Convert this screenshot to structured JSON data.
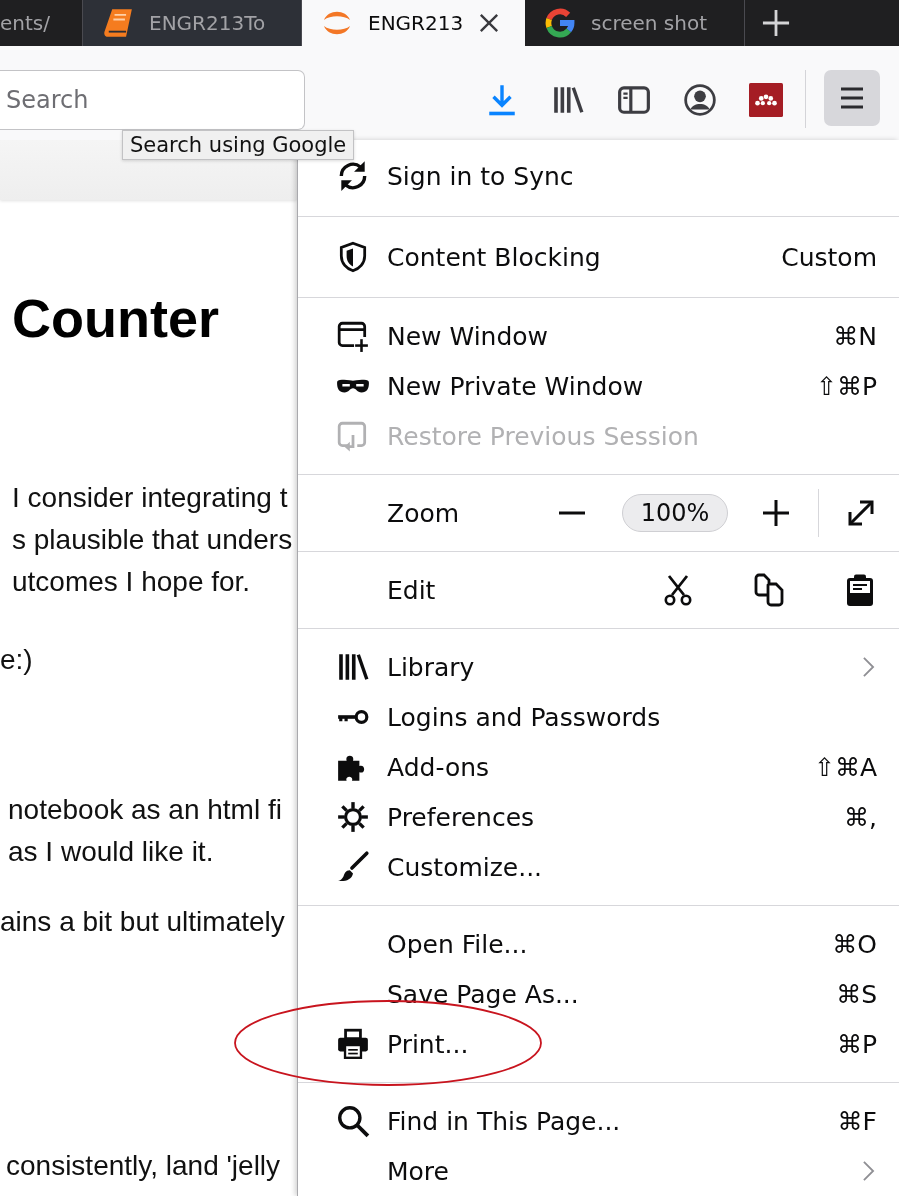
{
  "tabs": [
    {
      "title": "ents/",
      "selected": false,
      "hovered": false
    },
    {
      "title": "ENGR213To",
      "selected": false,
      "hovered": true
    },
    {
      "title": "ENGR213",
      "selected": true,
      "hovered": false
    },
    {
      "title": "screen shot",
      "selected": false,
      "hovered": false
    }
  ],
  "search": {
    "placeholder": "Search"
  },
  "tooltip": "Search using Google",
  "page": {
    "heading": "Counter",
    "paragraphs": [
      [
        "I consider integrating t",
        "s plausible that unders",
        "utcomes I hope for."
      ],
      [
        "e:)"
      ],
      [
        "notebook as an html fi",
        "as I would like it."
      ],
      [
        "ains a bit but ultimately"
      ],
      [
        "consistently, land 'jelly"
      ]
    ]
  },
  "menu": {
    "open": true,
    "sections": [
      {
        "items": [
          {
            "kind": "item",
            "label": "Sign in to Sync",
            "disabled": false,
            "submenu": false
          }
        ]
      },
      {
        "items": [
          {
            "kind": "item",
            "label": "Content Blocking",
            "value": "Custom",
            "disabled": false,
            "submenu": false
          }
        ]
      },
      {
        "items": [
          {
            "kind": "item",
            "label": "New Window",
            "shortcut": "⌘N",
            "disabled": false,
            "submenu": false
          },
          {
            "kind": "item",
            "label": "New Private Window",
            "shortcut": "⇧⌘P",
            "disabled": false,
            "submenu": false
          },
          {
            "kind": "item",
            "label": "Restore Previous Session",
            "disabled": true,
            "submenu": false
          }
        ]
      },
      {
        "items": [
          {
            "kind": "zoom",
            "label": "Zoom",
            "level_text": "100%"
          }
        ]
      },
      {
        "items": [
          {
            "kind": "edit",
            "label": "Edit"
          }
        ]
      },
      {
        "items": [
          {
            "kind": "item",
            "label": "Library",
            "disabled": false,
            "submenu": true
          },
          {
            "kind": "item",
            "label": "Logins and Passwords",
            "disabled": false,
            "submenu": false
          },
          {
            "kind": "item",
            "label": "Add-ons",
            "shortcut": "⇧⌘A",
            "disabled": false,
            "submenu": false
          },
          {
            "kind": "item",
            "label": "Preferences",
            "shortcut": "⌘,",
            "disabled": false,
            "submenu": false
          },
          {
            "kind": "item",
            "label": "Customize...",
            "disabled": false,
            "submenu": false
          }
        ]
      },
      {
        "items": [
          {
            "kind": "item",
            "label": "Open File...",
            "shortcut": "⌘O",
            "disabled": false,
            "submenu": false
          },
          {
            "kind": "item",
            "label": "Save Page As...",
            "shortcut": "⌘S",
            "disabled": false,
            "submenu": false
          },
          {
            "kind": "item",
            "label": "Print...",
            "shortcut": "⌘P",
            "disabled": false,
            "submenu": false
          }
        ]
      },
      {
        "items": [
          {
            "kind": "item",
            "label": "Find in This Page...",
            "shortcut": "⌘F",
            "disabled": false,
            "submenu": false
          },
          {
            "kind": "item",
            "label": "More",
            "disabled": false,
            "submenu": true
          }
        ]
      }
    ]
  }
}
